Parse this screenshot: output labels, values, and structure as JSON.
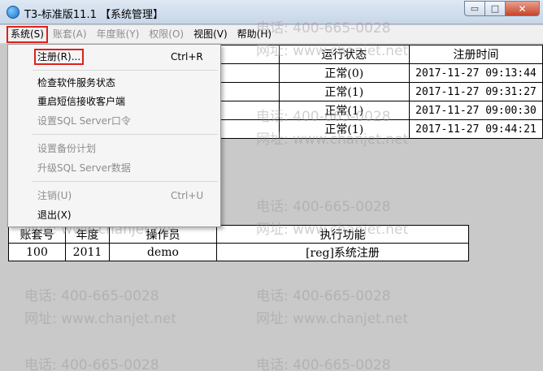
{
  "window": {
    "title": "T3-标准版11.1 【系统管理】",
    "controls": {
      "minimize": "▭",
      "maximize": "□",
      "close": "✕"
    }
  },
  "menubar": {
    "items": [
      {
        "label": "系统(S)"
      },
      {
        "label": "账套(A)"
      },
      {
        "label": "年度账(Y)"
      },
      {
        "label": "权限(O)"
      },
      {
        "label": "视图(V)"
      },
      {
        "label": "帮助(H)"
      }
    ]
  },
  "system_menu": {
    "items": [
      {
        "label": "注册(R)...",
        "shortcut": "Ctrl+R"
      },
      {
        "label": "检查软件服务状态"
      },
      {
        "label": "重启短信接收客户端"
      },
      {
        "label": "设置SQL Server口令"
      },
      {
        "label": "设置备份计划"
      },
      {
        "label": "升级SQL Server数据"
      },
      {
        "label": "注销(U)",
        "shortcut": "Ctrl+U"
      },
      {
        "label": "退出(X)"
      }
    ]
  },
  "session_table": {
    "headers": {
      "status": "运行状态",
      "time": "注册时间"
    },
    "rows": [
      {
        "status": "正常(0)",
        "time": "2017-11-27 09:13:44"
      },
      {
        "status": "正常(1)",
        "time": "2017-11-27 09:31:27"
      },
      {
        "status": "正常(1)",
        "time": "2017-11-27 09:00:30"
      },
      {
        "status": "正常(1)",
        "time": "2017-11-27 09:44:21"
      }
    ]
  },
  "task_table": {
    "headers": {
      "account": "账套号",
      "year": "年度",
      "operator": "操作员",
      "function": "执行功能"
    },
    "rows": [
      {
        "account": "100",
        "year": "2011",
        "operator": "demo",
        "function": "[reg]系统注册"
      }
    ]
  },
  "watermark": {
    "phone": "电话: 400-665-0028",
    "site": "网址: www.chanjet.net"
  }
}
